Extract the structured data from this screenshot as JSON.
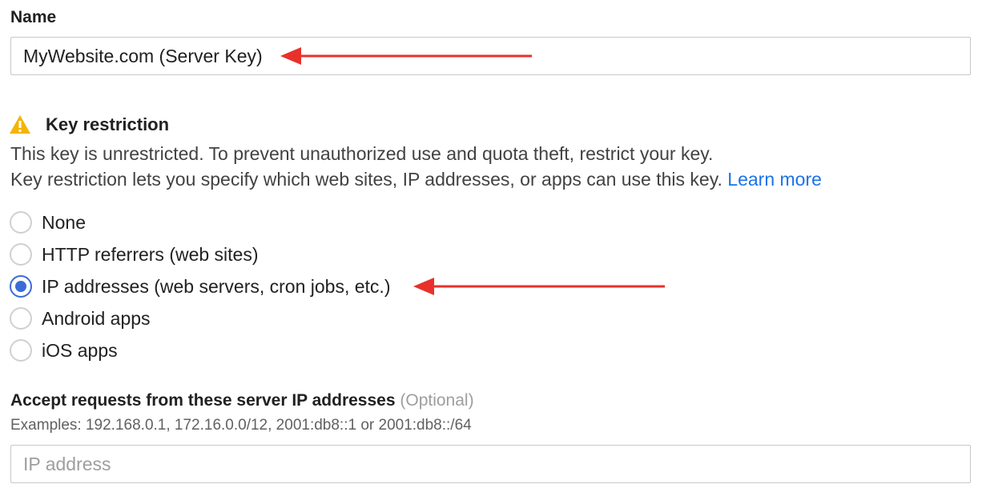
{
  "name_field": {
    "label": "Name",
    "value": "MyWebsite.com (Server Key)"
  },
  "key_restriction": {
    "warning_icon": "warning-triangle-icon",
    "title": "Key restriction",
    "line1": "This key is unrestricted. To prevent unauthorized use and quota theft, restrict your key.",
    "line2": "Key restriction lets you specify which web sites, IP addresses, or apps can use this key.",
    "learn_more": "Learn more",
    "options": [
      {
        "label": "None",
        "selected": false
      },
      {
        "label": "HTTP referrers (web sites)",
        "selected": false
      },
      {
        "label": "IP addresses (web servers, cron jobs, etc.)",
        "selected": true
      },
      {
        "label": "Android apps",
        "selected": false
      },
      {
        "label": "iOS apps",
        "selected": false
      }
    ]
  },
  "ip_section": {
    "label": "Accept requests from these server IP addresses",
    "optional": "(Optional)",
    "examples": "Examples: 192.168.0.1, 172.16.0.0/12, 2001:db8::1 or 2001:db8::/64",
    "placeholder": "IP address",
    "value": ""
  },
  "colors": {
    "accent": "#3b6bd8",
    "link": "#1a73e8",
    "warning": "#f4b400",
    "annotation_arrow": "#e8312a"
  }
}
